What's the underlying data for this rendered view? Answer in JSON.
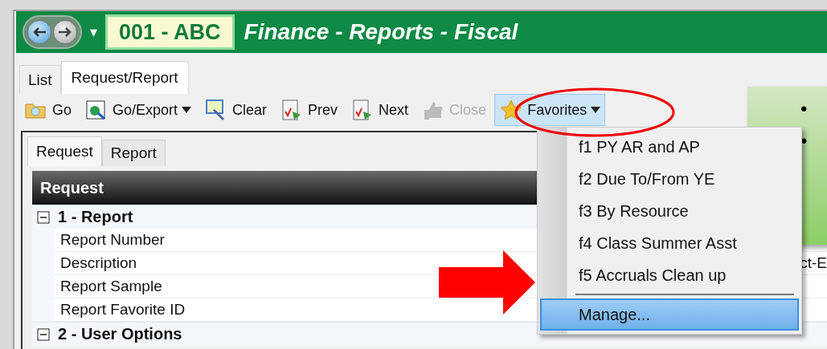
{
  "header": {
    "nav_menu_caret": "▾",
    "code": "001 - ABC",
    "title": "Finance - Reports - Fiscal"
  },
  "tabs": [
    {
      "label": "List",
      "selected": false
    },
    {
      "label": "Request/Report",
      "selected": true
    }
  ],
  "toolbar": [
    {
      "label": "Go",
      "disabled": false,
      "has_menu": false,
      "selected": false
    },
    {
      "label": "Go/Export",
      "disabled": false,
      "has_menu": true,
      "selected": false
    },
    {
      "label": "Clear",
      "disabled": false,
      "has_menu": false,
      "selected": false
    },
    {
      "label": "Prev",
      "disabled": false,
      "has_menu": false,
      "selected": false
    },
    {
      "label": "Next",
      "disabled": false,
      "has_menu": false,
      "selected": false
    },
    {
      "label": "Close",
      "disabled": true,
      "has_menu": false,
      "selected": false
    },
    {
      "label": "Favorites",
      "disabled": false,
      "has_menu": true,
      "selected": true
    }
  ],
  "subtabs": [
    {
      "label": "Request",
      "selected": true
    },
    {
      "label": "Report",
      "selected": false
    }
  ],
  "grid": {
    "title": "Request",
    "sections": [
      {
        "label": "1 - Report",
        "expanded": true,
        "fields": [
          {
            "label": "Report Number"
          },
          {
            "label": "Description",
            "value": "ct-E"
          },
          {
            "label": "Report Sample"
          },
          {
            "label": "Report Favorite ID"
          }
        ]
      },
      {
        "label": "2 - User Options",
        "expanded": true
      }
    ]
  },
  "favorites_menu": {
    "items": [
      {
        "kind": "item",
        "label": "f1 PY AR and AP",
        "selected": false
      },
      {
        "kind": "item",
        "label": "f2 Due To/From YE",
        "selected": false
      },
      {
        "kind": "item",
        "label": "f3 By Resource",
        "selected": false
      },
      {
        "kind": "item",
        "label": "f4 Class Summer Asst",
        "selected": false
      },
      {
        "kind": "item",
        "label": "f5 Accruals Clean up",
        "selected": false
      },
      {
        "kind": "separator"
      },
      {
        "kind": "item",
        "label": "Manage...",
        "selected": true
      }
    ]
  },
  "callout": {
    "bullets": [
      "•",
      "•"
    ]
  }
}
